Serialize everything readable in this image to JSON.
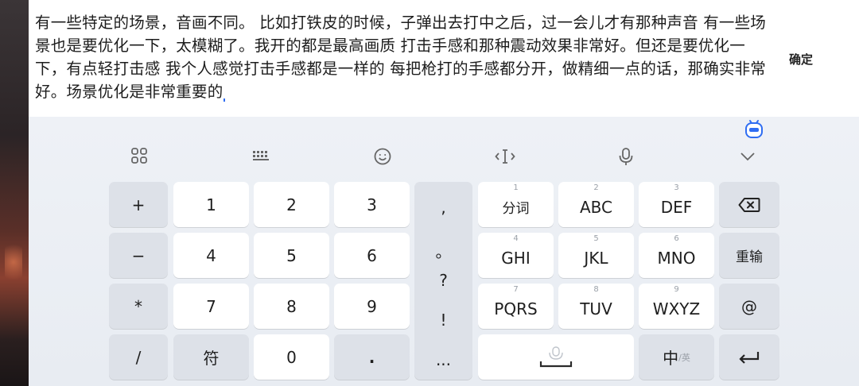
{
  "editor": {
    "text": "有一些特定的场景，音画不同。 比如打铁皮的时候，子弹出去打中之后，过一会儿才有那种声音 有一些场景也是要优化一下，太模糊了。我开的都是最高画质 打击手感和那种震动效果非常好。但还是要优化一下，有点轻打击感 我个人感觉打击手感都是一样的 每把枪打的手感都分开，做精细一点的话，那确实非常好。场景优化是非常重要的",
    "confirm_label": "确定"
  },
  "toolbar": {
    "items": [
      "menu-grid-icon",
      "keyboard-icon",
      "emoji-icon",
      "cursor-edit-icon",
      "microphone-icon",
      "collapse-chevron-icon"
    ]
  },
  "keyboard": {
    "left_col": [
      "+",
      "−",
      "*",
      "/"
    ],
    "digits": [
      "1",
      "2",
      "3",
      "4",
      "5",
      "6",
      "7",
      "8",
      "9",
      "0"
    ],
    "symbol_label": "符",
    "dot_label": ".",
    "punct": [
      ",",
      "。",
      "?",
      "!",
      "..."
    ],
    "letters": [
      {
        "num": "1",
        "label": "分词"
      },
      {
        "num": "2",
        "label": "ABC"
      },
      {
        "num": "3",
        "label": "DEF"
      },
      {
        "num": "4",
        "label": "GHI"
      },
      {
        "num": "5",
        "label": "JKL"
      },
      {
        "num": "6",
        "label": "MNO"
      },
      {
        "num": "7",
        "label": "PQRS"
      },
      {
        "num": "8",
        "label": "TUV"
      },
      {
        "num": "9",
        "label": "WXYZ"
      }
    ],
    "reenter_label": "重输",
    "at_label": "@",
    "lang_main": "中",
    "lang_sub": "/英"
  }
}
